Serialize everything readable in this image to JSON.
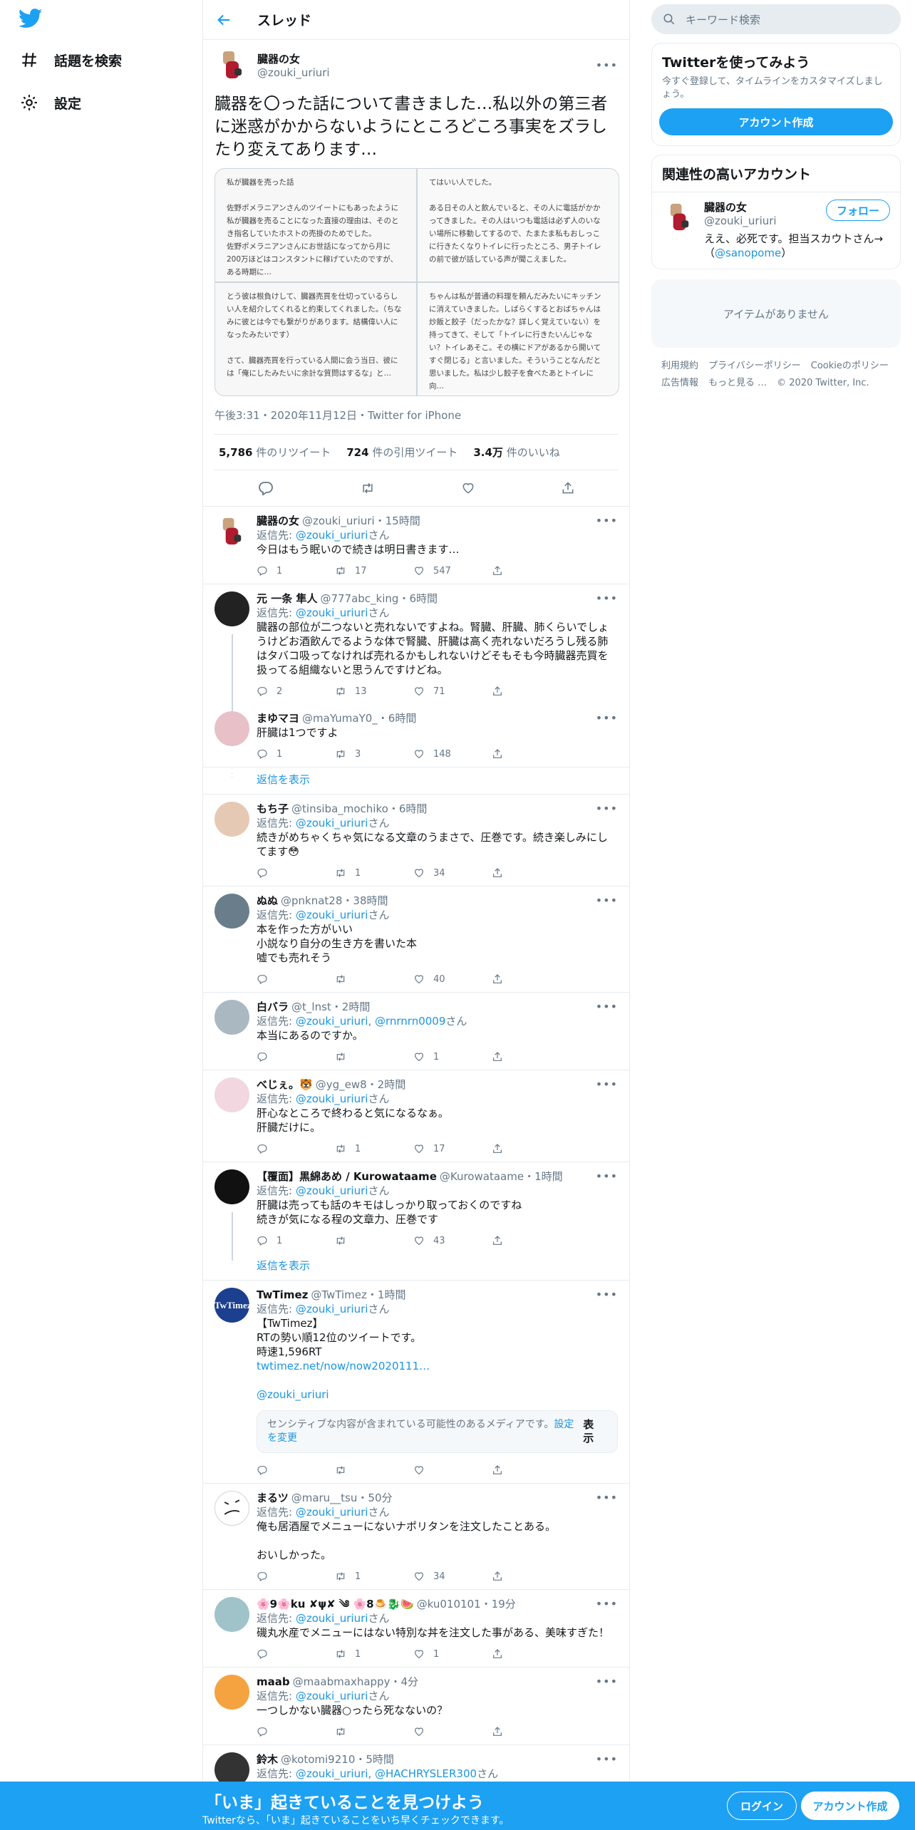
{
  "colors": {
    "brand": "#1da1f2",
    "text": "#14171a",
    "muted": "#657786",
    "border": "#e6ecf0",
    "like": "#657786"
  },
  "sidebar": {
    "logo_icon": "twitter-bird-icon",
    "items": [
      {
        "label": "話題を検索",
        "icon": "hashtag-icon"
      },
      {
        "label": "設定",
        "icon": "gear-icon"
      }
    ]
  },
  "header": {
    "title": "スレッド",
    "back_icon": "arrow-left-icon"
  },
  "focal": {
    "name": "臓器の女",
    "handle": "@zouki_uriuri",
    "text": "臓器を〇った話について書きました…私以外の第三者に迷惑がかからないようにところどころ事実をズラしたり変えてあります…",
    "memos": [
      "私が臓器を売った話\n\n佐野ポメラニアンさんのツイートにもあったように私が臓器を売ることになった直接の理由は、そのとき指名していたホストの売掛のためでした。\n佐野ポメラニアンさんにお世話になってから月に200万ほどはコンスタントに稼げていたのですが、ある時期に…",
      "てはいい人でした。\n\nある日その人と飲んでいると、その人に電話がかかってきました。その人はいつも電話は必ず人のいない場所に移動してするので、たまたま私もおしっこに行きたくなりトイレに行ったところ、男子トイレの前で彼が話している声が聞こえました。",
      "とう彼は根負けして、臓器売買を仕切っているらしい人を紹介してくれると約束してくれました。（ちなみに彼とは今でも繋がりがあります。結構偉い人になったみたいです）\n\nさて、臓器売買を行っている人間に会う当日、彼には「俺にしたみたいに余計な質問はするな」と…",
      "ちゃんは私が普通の料理を頼んだみたいにキッチンに消えていきました。しばらくするとおばちゃんは炒飯と餃子（だったかな？詳しく覚えていない）を持ってきて、そして「トイレに行きたいんじゃない？トイレあそこ。その横にドアがあるから開いてすぐ閉じる」と言いました。そういうことなんだと思いました。私は少し餃子を食べたあとトイレに向…"
    ],
    "timestamp": "午後3:31・2020年11月12日・Twitter for iPhone",
    "stats": [
      {
        "count": "5,786",
        "label": "件のリツイート"
      },
      {
        "count": "724",
        "label": "件の引用ツイート"
      },
      {
        "count": "3.4万",
        "label": "件のいいね"
      }
    ]
  },
  "replies": [
    {
      "name": "臓器の女",
      "handle": "@zouki_uriuri",
      "time": "15時間",
      "reply_to": "返信先: ",
      "mention": "@zouki_uriuri",
      "suffix": "さん",
      "text": "今日はもう眠いので続きは明日書きます…",
      "replies": "1",
      "retweets": "17",
      "likes": "547"
    },
    {
      "name": "元 一条 隼人",
      "handle": "@777abc_king",
      "time": "6時間",
      "reply_to": "返信先: ",
      "mention": "@zouki_uriuri",
      "suffix": "さん",
      "text": "臓器の部位が二つないと売れないですよね。腎臓、肝臓、肺くらいでしょうけどお酒飲んでるような体で腎臓、肝臓は高く売れないだろうし残る肺はタバコ吸ってなければ売れるかもしれないけどそもそも今時臓器売買を扱ってる組織ないと思うんですけどね。",
      "replies": "2",
      "retweets": "13",
      "likes": "71"
    },
    {
      "name": "まゆマヨ",
      "handle": "@maYumaY0_",
      "time": "6時間",
      "text": "肝臓は1つですよ",
      "replies": "1",
      "retweets": "3",
      "likes": "148"
    },
    {
      "name": "もち子",
      "handle": "@tinsiba_mochiko",
      "time": "6時間",
      "reply_to": "返信先: ",
      "mention": "@zouki_uriuri",
      "suffix": "さん",
      "text": "続きがめちゃくちゃ気になる文章のうまさで、圧巻です。続き楽しみにしてます😳",
      "replies": "",
      "retweets": "1",
      "likes": "34"
    },
    {
      "name": "ぬぬ",
      "handle": "@pnknat28",
      "time": "38時間",
      "reply_to": "返信先: ",
      "mention": "@zouki_uriuri",
      "suffix": "さん",
      "text": "本を作った方がいい\n小説なり自分の生き方を書いた本\n嘘でも売れそう",
      "replies": "",
      "retweets": "",
      "likes": "40"
    },
    {
      "name": "白バラ",
      "handle": "@t_lnst",
      "time": "2時間",
      "reply_to": "返信先: ",
      "mention": "@zouki_uriuri",
      "mention2": "@rnrnrn0009",
      "suffix": "さん",
      "text": "本当にあるのですか。",
      "replies": "",
      "retweets": "",
      "likes": "1"
    },
    {
      "name": "べじぇ。🐯",
      "handle": "@yg_ew8",
      "time": "2時間",
      "reply_to": "返信先: ",
      "mention": "@zouki_uriuri",
      "suffix": "さん",
      "text": "肝心なところで終わると気になるなぁ。\n肝臓だけに。",
      "replies": "",
      "retweets": "1",
      "likes": "17"
    },
    {
      "name": "【覆面】黒綿あめ / Kurowataame",
      "handle": "@Kurowataame",
      "time": "1時間",
      "reply_to": "返信先: ",
      "mention": "@zouki_uriuri",
      "suffix": "さん",
      "text": "肝臓は売っても話のキモはしっかり取っておくのですね\n続きが気になる程の文章力、圧巻です",
      "replies": "1",
      "retweets": "",
      "likes": "43"
    },
    {
      "name": "TwTimez",
      "handle": "@TwTimez",
      "time": "1時間",
      "reply_to": "返信先: ",
      "mention": "@zouki_uriuri",
      "suffix": "さん",
      "text": "【TwTimez】\nRTの勢い順12位のツイートです。\n時速1,596RT",
      "link": "twtimez.net/now/now2020111…",
      "mention_line": "@zouki_uriuri",
      "sensitive_text": "センシティブな内容が含まれている可能性のあるメディアです。",
      "sensitive_link": "設定を変更",
      "sensitive_show": "表示",
      "replies": "",
      "retweets": "",
      "likes": ""
    },
    {
      "name": "まるツ",
      "handle": "@maru__tsu",
      "time": "50分",
      "reply_to": "返信先: ",
      "mention": "@zouki_uriuri",
      "suffix": "さん",
      "text": "俺も居酒屋でメニューにないナポリタンを注文したことある。\n\nおいしかった。",
      "replies": "",
      "retweets": "1",
      "likes": "34"
    },
    {
      "name": "🌸9🌸ku ✘ψ✘ ༄ 🌸8🍮🐉🍉",
      "handle": "@ku010101",
      "time": "19分",
      "reply_to": "返信先: ",
      "mention": "@zouki_uriuri",
      "suffix": "さん",
      "text": "磯丸水産でメニューにはない特別な丼を注文した事がある、美味すぎた！",
      "replies": "",
      "retweets": "1",
      "likes": "1"
    },
    {
      "name": "maab",
      "handle": "@maabmaxhappy",
      "time": "4分",
      "reply_to": "返信先: ",
      "mention": "@zouki_uriuri",
      "suffix": "さん",
      "text": "一つしかない臓器○ったら死なないの？",
      "replies": "",
      "retweets": "",
      "likes": ""
    },
    {
      "name": "鈴木",
      "handle": "@kotomi9210",
      "time": "5時間",
      "reply_to": "返信先: ",
      "mention": "@zouki_uriuri",
      "mention2": "@HACHRYSLER300",
      "suffix": "さん"
    }
  ],
  "show_more": "返信を表示",
  "right": {
    "search_placeholder": "キーワード検索",
    "signup": {
      "title": "Twitterを使ってみよう",
      "text": "今すぐ登録して、タイムラインをカスタマイズしましょう。",
      "button": "アカウント作成"
    },
    "related": {
      "title": "関連性の高いアカウント",
      "name": "臓器の女",
      "handle": "@zouki_uriuri",
      "follow": "フォロー",
      "bio": "ええ、必死です。担当スカウトさん→（",
      "bio_link": "@sanopome",
      "bio_end": "）"
    },
    "empty": "アイテムがありません",
    "footer": [
      "利用規約",
      "プライバシーポリシー",
      "Cookieのポリシー",
      "広告情報",
      "もっと見る …",
      "© 2020 Twitter, Inc."
    ]
  },
  "bottom": {
    "title": "「いま」起きていることを見つけよう",
    "sub": "Twitterなら、「いま」起きていることをいち早くチェックできます。",
    "login": "ログイン",
    "signup": "アカウント作成"
  }
}
